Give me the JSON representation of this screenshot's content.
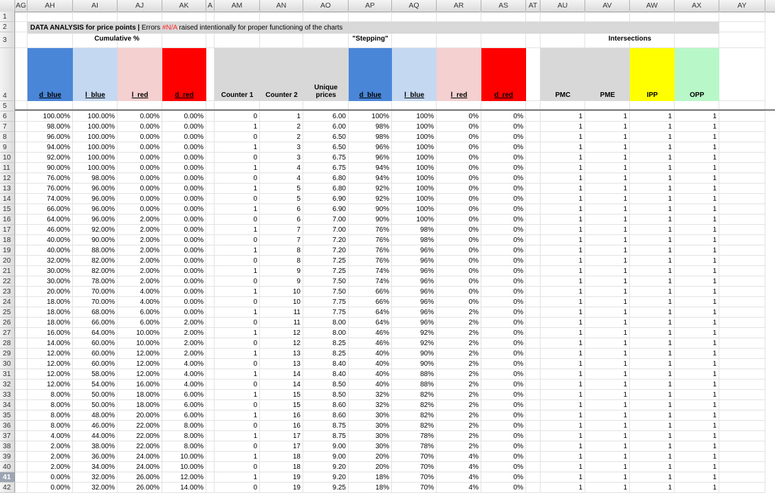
{
  "columns": [
    "AG",
    "AH",
    "AI",
    "AJ",
    "AK",
    "AL",
    "AM",
    "AN",
    "AO",
    "AP",
    "AQ",
    "AR",
    "AS",
    "AT",
    "AU",
    "AV",
    "AW",
    "AX",
    "AY"
  ],
  "column_labels_display": [
    "AG",
    "AH",
    "AI",
    "AJ",
    "AK",
    "A",
    "AM",
    "AN",
    "AO",
    "AP",
    "AQ",
    "AR",
    "AS",
    "AT",
    "AU",
    "AV",
    "AW",
    "AX",
    "AY"
  ],
  "banner": {
    "bold": "DATA ANALYSIS for price points | ",
    "before": "Errors ",
    "red": "#N/A",
    "after": " raised intentionally for proper functioning of the charts"
  },
  "sections": {
    "cumulative": "Cumulative %",
    "stepping": "\"Stepping\"",
    "intersections": "Intersections"
  },
  "headers": {
    "ah": "d_blue",
    "ai": "l_blue",
    "aj": "l_red",
    "ak": "d_red",
    "am": "Counter 1",
    "an": "Counter 2",
    "ao_line1": "Unique",
    "ao_line2": "prices",
    "ap": "d_blue",
    "aq": "l_blue",
    "ar": "l_red",
    "as": "d_red",
    "au": "PMC",
    "av": "PME",
    "aw": "IPP",
    "ax": "OPP"
  },
  "colors": {
    "d_blue": "#4a86d8",
    "l_blue": "#c5d8f1",
    "l_red": "#f5d0d0",
    "d_red": "#ff0000",
    "gray": "#d8d8d8",
    "yellow": "#ffff00",
    "green": "#b8f8c8"
  },
  "row_numbers": [
    "1",
    "2",
    "3",
    "4",
    "5",
    "6",
    "7",
    "8",
    "9",
    "10",
    "11",
    "12",
    "13",
    "14",
    "15",
    "16",
    "17",
    "18",
    "19",
    "20",
    "21",
    "22",
    "23",
    "24",
    "25",
    "26",
    "27",
    "28",
    "29",
    "30",
    "31",
    "32",
    "33",
    "34",
    "35",
    "36",
    "37",
    "38",
    "39",
    "40",
    "41",
    "42"
  ],
  "selected_row": "41",
  "data_rows": [
    [
      "100.00%",
      "100.00%",
      "0.00%",
      "0.00%",
      "0",
      "1",
      "6.00",
      "100%",
      "100%",
      "0%",
      "0%",
      "1",
      "1",
      "1",
      "1"
    ],
    [
      "98.00%",
      "100.00%",
      "0.00%",
      "0.00%",
      "1",
      "2",
      "6.00",
      "98%",
      "100%",
      "0%",
      "0%",
      "1",
      "1",
      "1",
      "1"
    ],
    [
      "96.00%",
      "100.00%",
      "0.00%",
      "0.00%",
      "0",
      "2",
      "6.50",
      "98%",
      "100%",
      "0%",
      "0%",
      "1",
      "1",
      "1",
      "1"
    ],
    [
      "94.00%",
      "100.00%",
      "0.00%",
      "0.00%",
      "1",
      "3",
      "6.50",
      "96%",
      "100%",
      "0%",
      "0%",
      "1",
      "1",
      "1",
      "1"
    ],
    [
      "92.00%",
      "100.00%",
      "0.00%",
      "0.00%",
      "0",
      "3",
      "6.75",
      "96%",
      "100%",
      "0%",
      "0%",
      "1",
      "1",
      "1",
      "1"
    ],
    [
      "90.00%",
      "100.00%",
      "0.00%",
      "0.00%",
      "1",
      "4",
      "6.75",
      "94%",
      "100%",
      "0%",
      "0%",
      "1",
      "1",
      "1",
      "1"
    ],
    [
      "76.00%",
      "98.00%",
      "0.00%",
      "0.00%",
      "0",
      "4",
      "6.80",
      "94%",
      "100%",
      "0%",
      "0%",
      "1",
      "1",
      "1",
      "1"
    ],
    [
      "76.00%",
      "96.00%",
      "0.00%",
      "0.00%",
      "1",
      "5",
      "6.80",
      "92%",
      "100%",
      "0%",
      "0%",
      "1",
      "1",
      "1",
      "1"
    ],
    [
      "74.00%",
      "96.00%",
      "0.00%",
      "0.00%",
      "0",
      "5",
      "6.90",
      "92%",
      "100%",
      "0%",
      "0%",
      "1",
      "1",
      "1",
      "1"
    ],
    [
      "66.00%",
      "96.00%",
      "0.00%",
      "0.00%",
      "1",
      "6",
      "6.90",
      "90%",
      "100%",
      "0%",
      "0%",
      "1",
      "1",
      "1",
      "1"
    ],
    [
      "64.00%",
      "96.00%",
      "2.00%",
      "0.00%",
      "0",
      "6",
      "7.00",
      "90%",
      "100%",
      "0%",
      "0%",
      "1",
      "1",
      "1",
      "1"
    ],
    [
      "46.00%",
      "92.00%",
      "2.00%",
      "0.00%",
      "1",
      "7",
      "7.00",
      "76%",
      "98%",
      "0%",
      "0%",
      "1",
      "1",
      "1",
      "1"
    ],
    [
      "40.00%",
      "90.00%",
      "2.00%",
      "0.00%",
      "0",
      "7",
      "7.20",
      "76%",
      "98%",
      "0%",
      "0%",
      "1",
      "1",
      "1",
      "1"
    ],
    [
      "40.00%",
      "88.00%",
      "2.00%",
      "0.00%",
      "1",
      "8",
      "7.20",
      "76%",
      "96%",
      "0%",
      "0%",
      "1",
      "1",
      "1",
      "1"
    ],
    [
      "32.00%",
      "82.00%",
      "2.00%",
      "0.00%",
      "0",
      "8",
      "7.25",
      "76%",
      "96%",
      "0%",
      "0%",
      "1",
      "1",
      "1",
      "1"
    ],
    [
      "30.00%",
      "82.00%",
      "2.00%",
      "0.00%",
      "1",
      "9",
      "7.25",
      "74%",
      "96%",
      "0%",
      "0%",
      "1",
      "1",
      "1",
      "1"
    ],
    [
      "30.00%",
      "78.00%",
      "2.00%",
      "0.00%",
      "0",
      "9",
      "7.50",
      "74%",
      "96%",
      "0%",
      "0%",
      "1",
      "1",
      "1",
      "1"
    ],
    [
      "20.00%",
      "70.00%",
      "4.00%",
      "0.00%",
      "1",
      "10",
      "7.50",
      "66%",
      "96%",
      "0%",
      "0%",
      "1",
      "1",
      "1",
      "1"
    ],
    [
      "18.00%",
      "70.00%",
      "4.00%",
      "0.00%",
      "0",
      "10",
      "7.75",
      "66%",
      "96%",
      "0%",
      "0%",
      "1",
      "1",
      "1",
      "1"
    ],
    [
      "18.00%",
      "68.00%",
      "6.00%",
      "0.00%",
      "1",
      "11",
      "7.75",
      "64%",
      "96%",
      "2%",
      "0%",
      "1",
      "1",
      "1",
      "1"
    ],
    [
      "18.00%",
      "66.00%",
      "6.00%",
      "2.00%",
      "0",
      "11",
      "8.00",
      "64%",
      "96%",
      "2%",
      "0%",
      "1",
      "1",
      "1",
      "1"
    ],
    [
      "16.00%",
      "64.00%",
      "10.00%",
      "2.00%",
      "1",
      "12",
      "8.00",
      "46%",
      "92%",
      "2%",
      "0%",
      "1",
      "1",
      "1",
      "1"
    ],
    [
      "14.00%",
      "60.00%",
      "10.00%",
      "2.00%",
      "0",
      "12",
      "8.25",
      "46%",
      "92%",
      "2%",
      "0%",
      "1",
      "1",
      "1",
      "1"
    ],
    [
      "12.00%",
      "60.00%",
      "12.00%",
      "2.00%",
      "1",
      "13",
      "8.25",
      "40%",
      "90%",
      "2%",
      "0%",
      "1",
      "1",
      "1",
      "1"
    ],
    [
      "12.00%",
      "60.00%",
      "12.00%",
      "4.00%",
      "0",
      "13",
      "8.40",
      "40%",
      "90%",
      "2%",
      "0%",
      "1",
      "1",
      "1",
      "1"
    ],
    [
      "12.00%",
      "58.00%",
      "12.00%",
      "4.00%",
      "1",
      "14",
      "8.40",
      "40%",
      "88%",
      "2%",
      "0%",
      "1",
      "1",
      "1",
      "1"
    ],
    [
      "12.00%",
      "54.00%",
      "16.00%",
      "4.00%",
      "0",
      "14",
      "8.50",
      "40%",
      "88%",
      "2%",
      "0%",
      "1",
      "1",
      "1",
      "1"
    ],
    [
      "8.00%",
      "50.00%",
      "18.00%",
      "6.00%",
      "1",
      "15",
      "8.50",
      "32%",
      "82%",
      "2%",
      "0%",
      "1",
      "1",
      "1",
      "1"
    ],
    [
      "8.00%",
      "50.00%",
      "18.00%",
      "6.00%",
      "0",
      "15",
      "8.60",
      "32%",
      "82%",
      "2%",
      "0%",
      "1",
      "1",
      "1",
      "1"
    ],
    [
      "8.00%",
      "48.00%",
      "20.00%",
      "6.00%",
      "1",
      "16",
      "8.60",
      "30%",
      "82%",
      "2%",
      "0%",
      "1",
      "1",
      "1",
      "1"
    ],
    [
      "8.00%",
      "46.00%",
      "22.00%",
      "8.00%",
      "0",
      "16",
      "8.75",
      "30%",
      "82%",
      "2%",
      "0%",
      "1",
      "1",
      "1",
      "1"
    ],
    [
      "4.00%",
      "44.00%",
      "22.00%",
      "8.00%",
      "1",
      "17",
      "8.75",
      "30%",
      "78%",
      "2%",
      "0%",
      "1",
      "1",
      "1",
      "1"
    ],
    [
      "2.00%",
      "38.00%",
      "22.00%",
      "8.00%",
      "0",
      "17",
      "9.00",
      "30%",
      "78%",
      "2%",
      "0%",
      "1",
      "1",
      "1",
      "1"
    ],
    [
      "2.00%",
      "36.00%",
      "24.00%",
      "10.00%",
      "1",
      "18",
      "9.00",
      "20%",
      "70%",
      "4%",
      "0%",
      "1",
      "1",
      "1",
      "1"
    ],
    [
      "2.00%",
      "34.00%",
      "24.00%",
      "10.00%",
      "0",
      "18",
      "9.20",
      "20%",
      "70%",
      "4%",
      "0%",
      "1",
      "1",
      "1",
      "1"
    ],
    [
      "0.00%",
      "32.00%",
      "26.00%",
      "12.00%",
      "1",
      "19",
      "9.20",
      "18%",
      "70%",
      "4%",
      "0%",
      "1",
      "1",
      "1",
      "1"
    ],
    [
      "0.00%",
      "32.00%",
      "26.00%",
      "14.00%",
      "0",
      "19",
      "9.25",
      "18%",
      "70%",
      "4%",
      "0%",
      "1",
      "1",
      "1",
      "1"
    ]
  ]
}
